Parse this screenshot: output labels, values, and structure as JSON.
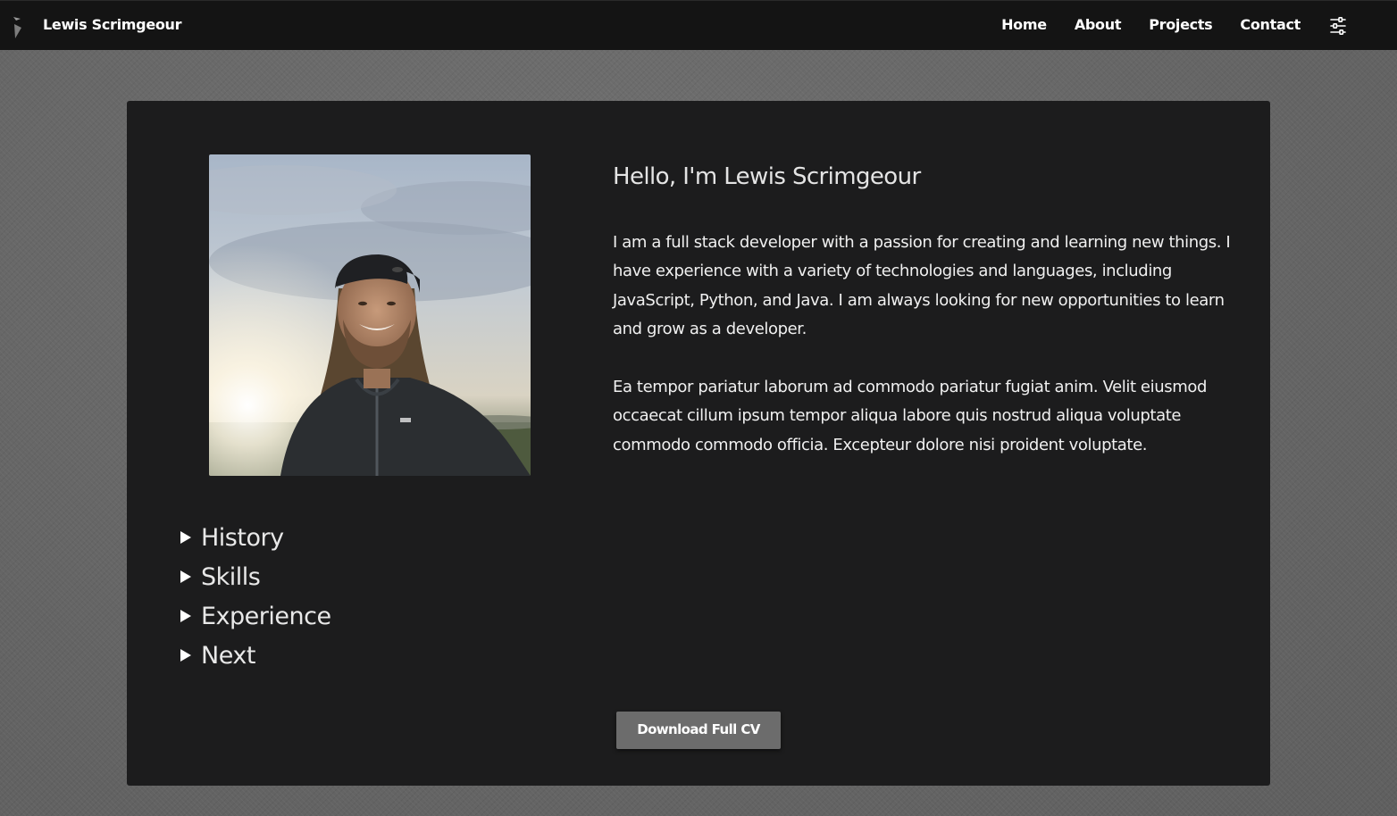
{
  "nav": {
    "brand": "Lewis Scrimgeour",
    "links": [
      "Home",
      "About",
      "Projects",
      "Contact"
    ],
    "logo_icon": "feather-logo-icon",
    "settings_icon": "sliders-icon"
  },
  "about": {
    "greeting": "Hello, I'm Lewis Scrimgeour",
    "bio_1": "I am a full stack developer with a passion for creating and learning new things. I have experience with a variety of technologies and languages, including JavaScript, Python, and Java. I am always looking for new opportunities to learn and grow as a developer.",
    "bio_2": "Ea tempor pariatur laborum ad commodo pariatur fugiat anim. Velit eiusmod occaecat cillum ipsum tempor aliqua labore quis nostrud aliqua voluptate commodo commodo officia. Excepteur dolore nisi proident voluptate."
  },
  "sections": [
    "History",
    "Skills",
    "Experience",
    "Next"
  ],
  "cv_button": "Download Full CV",
  "colors": {
    "navbar": "#141414",
    "card": "#1c1c1d",
    "page_background": "#6b6b6b",
    "button": "#6c6c6c"
  }
}
